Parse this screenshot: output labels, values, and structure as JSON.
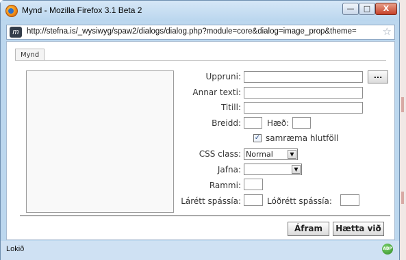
{
  "window": {
    "title": "Mynd - Mozilla Firefox 3.1 Beta 2",
    "min_label": "—",
    "max_label": "□",
    "close_label": "X"
  },
  "urlbar": {
    "site_icon_label": "m",
    "url": "http://stefna.is/_wysiwyg/spaw2/dialogs/dialog.php?module=core&dialog=image_prop&theme=",
    "star": "☆"
  },
  "tab": {
    "label": "Mynd"
  },
  "form": {
    "source_label": "Uppruni:",
    "source_value": "",
    "browse_label": "...",
    "alt_label": "Annar texti:",
    "alt_value": "",
    "title_label": "Titill:",
    "title_value": "",
    "width_label": "Breidd:",
    "width_value": "",
    "height_label": "Hæð:",
    "height_value": "",
    "constrain_label": "samræma hlutföll",
    "constrain_checked": "✓",
    "css_class_label": "CSS class:",
    "css_class_value": "Normal",
    "align_label": "Jafna:",
    "align_value": "",
    "border_label": "Rammi:",
    "border_value": "",
    "hspace_label": "Lárétt spássía:",
    "hspace_value": "",
    "vspace_label": "Lóðrétt spássía:",
    "vspace_value": ""
  },
  "actions": {
    "ok_label": "Áfram",
    "cancel_label": "Hætta við"
  },
  "status": {
    "text": "Lokið",
    "abp_label": "ABP"
  },
  "icons": {
    "app": "firefox-icon",
    "site": "site-favicon-icon",
    "star": "star-bookmark-icon",
    "abp": "adblock-plus-icon",
    "dropdown": "chevron-down-icon"
  }
}
